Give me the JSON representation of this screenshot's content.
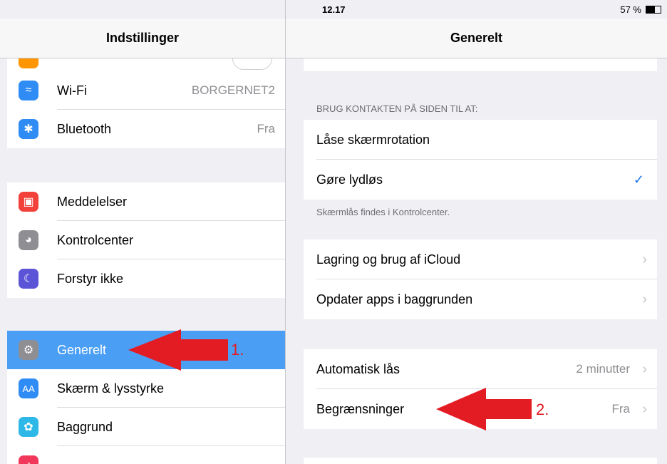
{
  "status": {
    "device": "iPad",
    "time": "12.17",
    "battery": "57 %"
  },
  "left": {
    "title": "Indstillinger",
    "group1": [
      {
        "label": "Wi-Fi",
        "value": "BORGERNET2",
        "icon": "wifi-icon",
        "color": "#2f8cf5"
      },
      {
        "label": "Bluetooth",
        "value": "Fra",
        "icon": "bluetooth-icon",
        "color": "#2f8cf5"
      }
    ],
    "group2": [
      {
        "label": "Meddelelser",
        "icon": "notifications-icon",
        "color": "#f2413a"
      },
      {
        "label": "Kontrolcenter",
        "icon": "control-center-icon",
        "color": "#8e8e93"
      },
      {
        "label": "Forstyr ikke",
        "icon": "moon-icon",
        "color": "#5b54d6"
      }
    ],
    "group3": [
      {
        "label": "Generelt",
        "icon": "gear-icon",
        "color": "#8e8e93",
        "selected": true
      },
      {
        "label": "Skærm & lysstyrke",
        "icon": "display-icon",
        "color": "#2f8cf5"
      },
      {
        "label": "Baggrund",
        "icon": "wallpaper-icon",
        "color": "#2eb8e8"
      }
    ]
  },
  "right": {
    "title": "Generelt",
    "section_header": "BRUG KONTAKTEN PÅ SIDEN TIL AT:",
    "switch_rows": [
      {
        "label": "Låse skærmrotation",
        "checked": false
      },
      {
        "label": "Gøre lydløs",
        "checked": true
      }
    ],
    "switch_footer": "Skærmlås findes i Kontrolcenter.",
    "storage_rows": [
      {
        "label": "Lagring og brug af iCloud"
      },
      {
        "label": "Opdater apps i baggrunden"
      }
    ],
    "lock_rows": [
      {
        "label": "Automatisk lås",
        "value": "2 minutter"
      },
      {
        "label": "Begrænsninger",
        "value": "Fra"
      }
    ]
  },
  "annotations": {
    "one": "1.",
    "two": "2.",
    "color": "#e31b23"
  }
}
